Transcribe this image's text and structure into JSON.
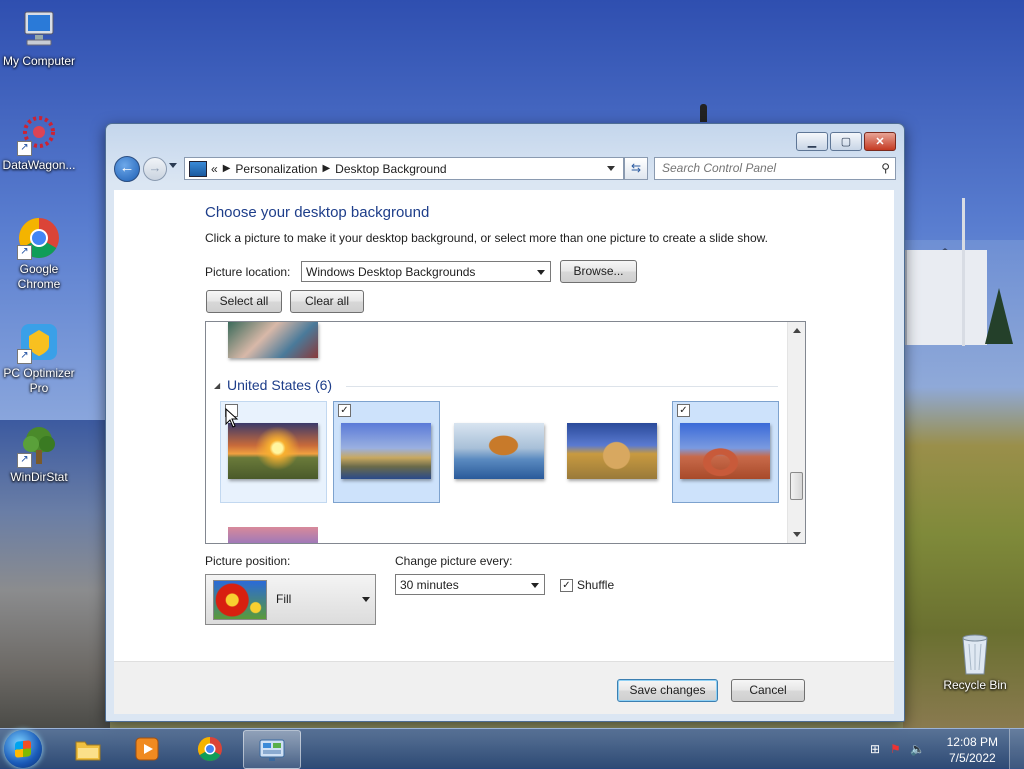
{
  "desktop": {
    "icons": [
      {
        "label": "My Computer",
        "icon": "computer-icon"
      },
      {
        "label": "DataWagon...",
        "icon": "datawagon-icon"
      },
      {
        "label": "Google Chrome",
        "icon": "chrome-icon"
      },
      {
        "label": "PC Optimizer Pro",
        "icon": "pc-optimizer-icon"
      },
      {
        "label": "WinDirStat",
        "icon": "windirstat-icon"
      },
      {
        "label": "Recycle Bin",
        "icon": "recycle-bin-icon"
      }
    ]
  },
  "window": {
    "address": {
      "prefix": "«",
      "crumbs": [
        "Personalization",
        "Desktop Background"
      ]
    },
    "search_placeholder": "Search Control Panel",
    "heading": "Choose your desktop background",
    "description": "Click a picture to make it your desktop background, or select more than one picture to create a slide show.",
    "picture_location": {
      "label": "Picture location:",
      "value": "Windows Desktop Backgrounds"
    },
    "browse_label": "Browse...",
    "select_all_label": "Select all",
    "clear_all_label": "Clear all",
    "gallery": {
      "group_title": "United States (6)",
      "tiles": [
        {
          "name": "sunset-field",
          "checked": false,
          "selected": false,
          "hover": true
        },
        {
          "name": "lighthouse",
          "checked": true,
          "selected": true,
          "hover": false
        },
        {
          "name": "rock-lake",
          "checked": false,
          "selected": false,
          "hover": false
        },
        {
          "name": "hay-bale",
          "checked": false,
          "selected": false,
          "hover": false
        },
        {
          "name": "delicate-arch",
          "checked": true,
          "selected": true,
          "hover": false
        }
      ]
    },
    "picture_position": {
      "label": "Picture position:",
      "value": "Fill"
    },
    "change_picture": {
      "label": "Change picture every:",
      "value": "30 minutes"
    },
    "shuffle": {
      "label": "Shuffle",
      "checked": true
    },
    "save_label": "Save changes",
    "cancel_label": "Cancel"
  },
  "taskbar": {
    "clock_time": "12:08 PM",
    "clock_date": "7/5/2022"
  }
}
